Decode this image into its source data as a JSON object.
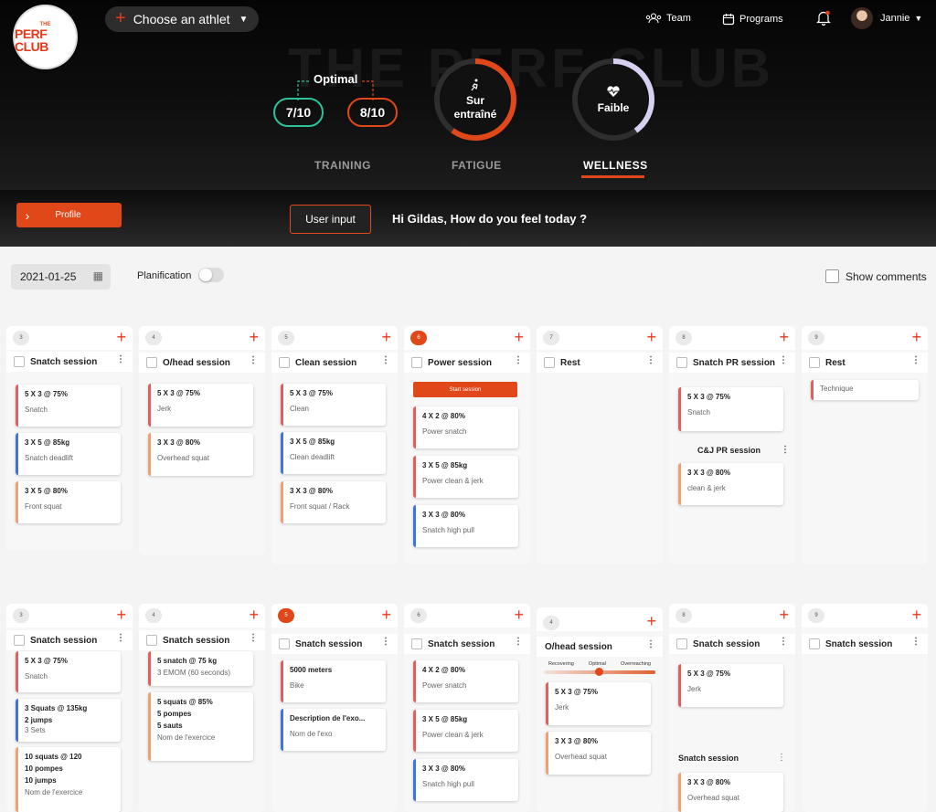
{
  "logo": {
    "top": "THE",
    "main": "PERF CLUB"
  },
  "athlete_picker": {
    "label": "Choose an athlet"
  },
  "nav": {
    "team": "Team",
    "programs": "Programs",
    "user": "Jannie"
  },
  "gauges": {
    "optimal_label": "Optimal",
    "score_left": "7/10",
    "score_right": "8/10",
    "fatigue_status": "Sur entraîné",
    "wellness_status": "Faible",
    "fatigue_level": 0.6,
    "wellness_level": 0.4,
    "watermark": "THE PERF CLUB"
  },
  "tabs": [
    "TRAINING",
    "FATIGUE",
    "WELLNESS"
  ],
  "active_tab": "WELLNESS",
  "colors": {
    "accent": "#e0481a",
    "optimal_green": "#2ec29a",
    "bar_red": "#e06060",
    "bar_blue": "#3f74e0",
    "bar_orange": "#f2a070"
  },
  "profile_button": "Profile",
  "user_input_button": "User input",
  "greeting": "Hi Gildas, How do you feel today ?",
  "toolbar": {
    "date": "2021-01-25",
    "planification": "Planification",
    "show_comments": "Show comments"
  },
  "week1": [
    {
      "day": "3",
      "title": "Snatch session",
      "exercises": [
        {
          "l1": "5 X 3 @ 75%",
          "l2": "Snatch",
          "color": "red"
        },
        {
          "l1": "3 X 5 @ 85kg",
          "l2": "Snatch deadlift",
          "color": "blue"
        },
        {
          "l1": "3 X 5 @ 80%",
          "l2": "Front squat",
          "color": "orange"
        }
      ]
    },
    {
      "day": "4",
      "title": "O/head session",
      "exercises": [
        {
          "l1": "5 X 3 @ 75%",
          "l2": "Jerk",
          "color": "red"
        },
        {
          "l1": "3 X 3 @ 80%",
          "l2": "Overhead squat",
          "color": "orange"
        }
      ]
    },
    {
      "day": "5",
      "title": "Clean session",
      "exercises": [
        {
          "l1": "5 X 3 @ 75%",
          "l2": "Clean",
          "color": "red"
        },
        {
          "l1": "3 X 5 @ 85kg",
          "l2": "Clean deadlift",
          "color": "blue"
        },
        {
          "l1": "3 X 3 @ 80%",
          "l2": "Front squat / Rack",
          "color": "orange"
        }
      ]
    },
    {
      "day": "6",
      "title": "Power session",
      "start": "Start session",
      "exercises": [
        {
          "l1": "4 X 2 @ 80%",
          "l2": "Power snatch",
          "color": "red"
        },
        {
          "l1": "3 X 5 @ 85kg",
          "l2": "Power clean & jerk",
          "color": "red"
        },
        {
          "l1": "3 X 3 @ 80%",
          "l2": "Snatch high pull",
          "color": "blue"
        }
      ]
    },
    {
      "day": "7",
      "title": "Rest",
      "exercises": []
    },
    {
      "day": "8",
      "title": "Snatch PR session",
      "sub_title": "C&J PR session",
      "exercises": [
        {
          "l1": "5 X 3 @ 75%",
          "l2": "Snatch",
          "color": "red"
        },
        {
          "l1": "3 X 3 @ 80%",
          "l2": "clean & jerk",
          "color": "orange"
        }
      ]
    },
    {
      "day": "9",
      "title": "Rest",
      "exercises": [
        {
          "l1": "",
          "l2": "Technique",
          "color": "red"
        }
      ]
    }
  ],
  "week2": [
    {
      "day": "3",
      "title": "Snatch session",
      "exercises": [
        {
          "l1": "5 X 3 @ 75%",
          "l2": "Snatch",
          "color": "red"
        },
        {
          "lines": [
            "3 Squats @ 135kg",
            "2 jumps"
          ],
          "grey": "3 Sets",
          "color": "blue"
        },
        {
          "lines": [
            "10 squats @ 120",
            "10 pompes",
            "10 jumps"
          ],
          "grey": "Nom de l'exercice",
          "color": "orange"
        }
      ]
    },
    {
      "day": "4",
      "title": "Snatch session",
      "exercises": [
        {
          "lines": [
            "5 snatch @ 75 kg"
          ],
          "grey": "3 EMOM (60 seconds)",
          "color": "red"
        },
        {
          "lines": [
            "5 squats @ 85%",
            "5 pompes",
            "5 sauts"
          ],
          "grey": "Nom de l'exercice",
          "color": "orange"
        }
      ]
    },
    {
      "day": "5",
      "title": "Snatch session",
      "exercises": [
        {
          "l1": "5000 meters",
          "l2": "Bike",
          "color": "red"
        },
        {
          "l1": "Description de l'exo...",
          "l2": "Nom de l'exo",
          "color": "blue"
        }
      ]
    },
    {
      "day": "6",
      "title": "Snatch session",
      "exercises": [
        {
          "l1": "4 X 2 @ 80%",
          "l2": "Power snatch",
          "color": "red"
        },
        {
          "l1": "3 X 5 @ 85kg",
          "l2": "Power clean & jerk",
          "color": "red"
        },
        {
          "l1": "3 X 3 @ 80%",
          "l2": "Snatch high pull",
          "color": "blue"
        }
      ]
    },
    {
      "day": "4",
      "title": "O/head session",
      "slider": {
        "labels": [
          "Recovering",
          "Optimal",
          "Overreaching"
        ]
      },
      "exercises": [
        {
          "l1": "5 X 3 @ 75%",
          "l2": "Jerk",
          "color": "red"
        },
        {
          "l1": "3 X 3 @ 80%",
          "l2": "Overhead squat",
          "color": "orange"
        }
      ]
    },
    {
      "day": "8",
      "title": "Snatch session",
      "sub_title": "Snatch session",
      "exercises": [
        {
          "l1": "5 X 3 @ 75%",
          "l2": "Jerk",
          "color": "red"
        },
        {
          "l1": "3 X 3 @ 80%",
          "l2": "Overhead squat",
          "color": "orange"
        }
      ]
    },
    {
      "day": "9",
      "title": "Snatch session",
      "exercises": []
    }
  ]
}
